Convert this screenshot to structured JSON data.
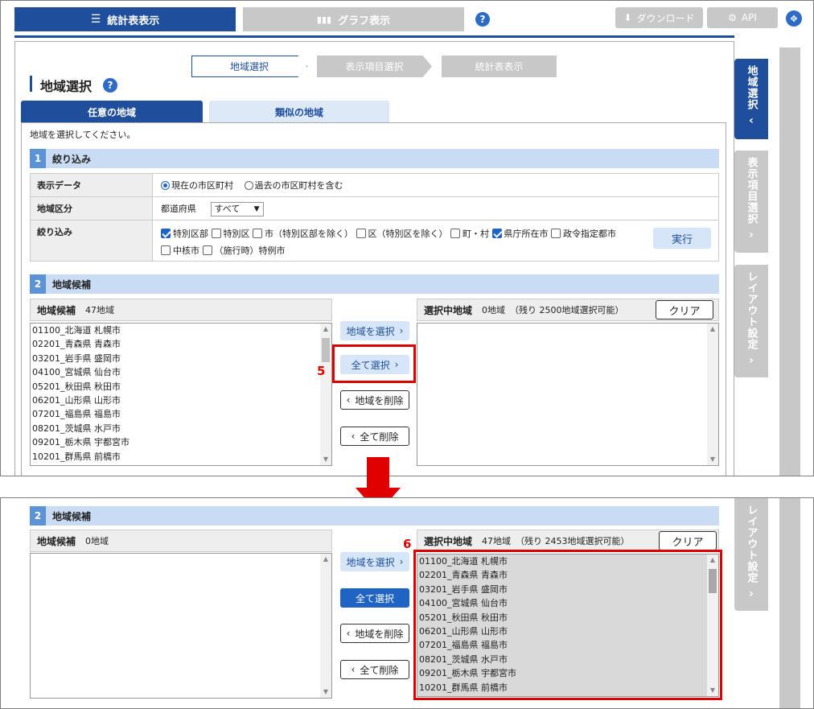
{
  "top": {
    "tabs": {
      "table": {
        "label": "統計表表示",
        "icon": "list-icon"
      },
      "graph": {
        "label": "グラフ表示",
        "icon": "bar-chart-icon"
      },
      "download": {
        "label": "ダウンロード",
        "icon": "download-icon"
      },
      "api": {
        "label": "API",
        "icon": "gears-icon"
      }
    },
    "steps": [
      "地域選択",
      "表示項目選択",
      "統計表表示"
    ],
    "title": "地域選択",
    "subtabs": {
      "any": "任意の地域",
      "similar": "類似の地域"
    },
    "instruction": "地域を選択してください。",
    "section1": {
      "num": "1",
      "title": "絞り込み"
    },
    "filters": {
      "display_label": "表示データ",
      "radio_current": "現在の市区町村",
      "radio_past": "過去の市区町村を含む",
      "area_label": "地域区分",
      "area_prefix": "都道府県",
      "area_value": "すべて",
      "narrow_label": "絞り込み",
      "checks": [
        "特別区部",
        "特別区",
        "市（特別区部を除く）",
        "区（特別区を除く）",
        "町・村",
        "県庁所在市",
        "政令指定都市",
        "中核市",
        "（施行時）特例市"
      ],
      "run_button": "実行"
    },
    "section2": {
      "num": "2",
      "title": "地域候補"
    },
    "candidates": {
      "title": "地域候補",
      "count": "47地域"
    },
    "selected": {
      "title": "選択中地域",
      "count": "0地域",
      "remaining": "（残り 2500地域選択可能）",
      "clear": "クリア"
    },
    "buttons": {
      "select": "地域を選択",
      "select_all": "全て選択",
      "delete": "地域を削除",
      "delete_all": "全て削除"
    },
    "annotation": "5",
    "side_tabs": [
      "地域選択",
      "表示項目選択",
      "レイアウト設定"
    ]
  },
  "bottom": {
    "section2": {
      "num": "2",
      "title": "地域候補"
    },
    "candidates": {
      "title": "地域候補",
      "count": "0地域"
    },
    "selected": {
      "title": "選択中地域",
      "count": "47地域",
      "remaining": "（残り 2453地域選択可能）",
      "clear": "クリア"
    },
    "buttons": {
      "select": "地域を選択",
      "select_all": "全て選択",
      "delete": "地域を削除",
      "delete_all": "全て削除"
    },
    "annotation": "6",
    "side_tab": "レイアウト設定"
  },
  "regions": [
    "01100_北海道 札幌市",
    "02201_青森県 青森市",
    "03201_岩手県 盛岡市",
    "04100_宮城県 仙台市",
    "05201_秋田県 秋田市",
    "06201_山形県 山形市",
    "07201_福島県 福島市",
    "08201_茨城県 水戸市",
    "09201_栃木県 宇都宮市",
    "10201_群馬県 前橋市"
  ],
  "colors": {
    "primary": "#1f64c4",
    "accent_red": "#e00000",
    "section_bg": "#c9dcf4",
    "disabled": "#c8c8c8"
  }
}
